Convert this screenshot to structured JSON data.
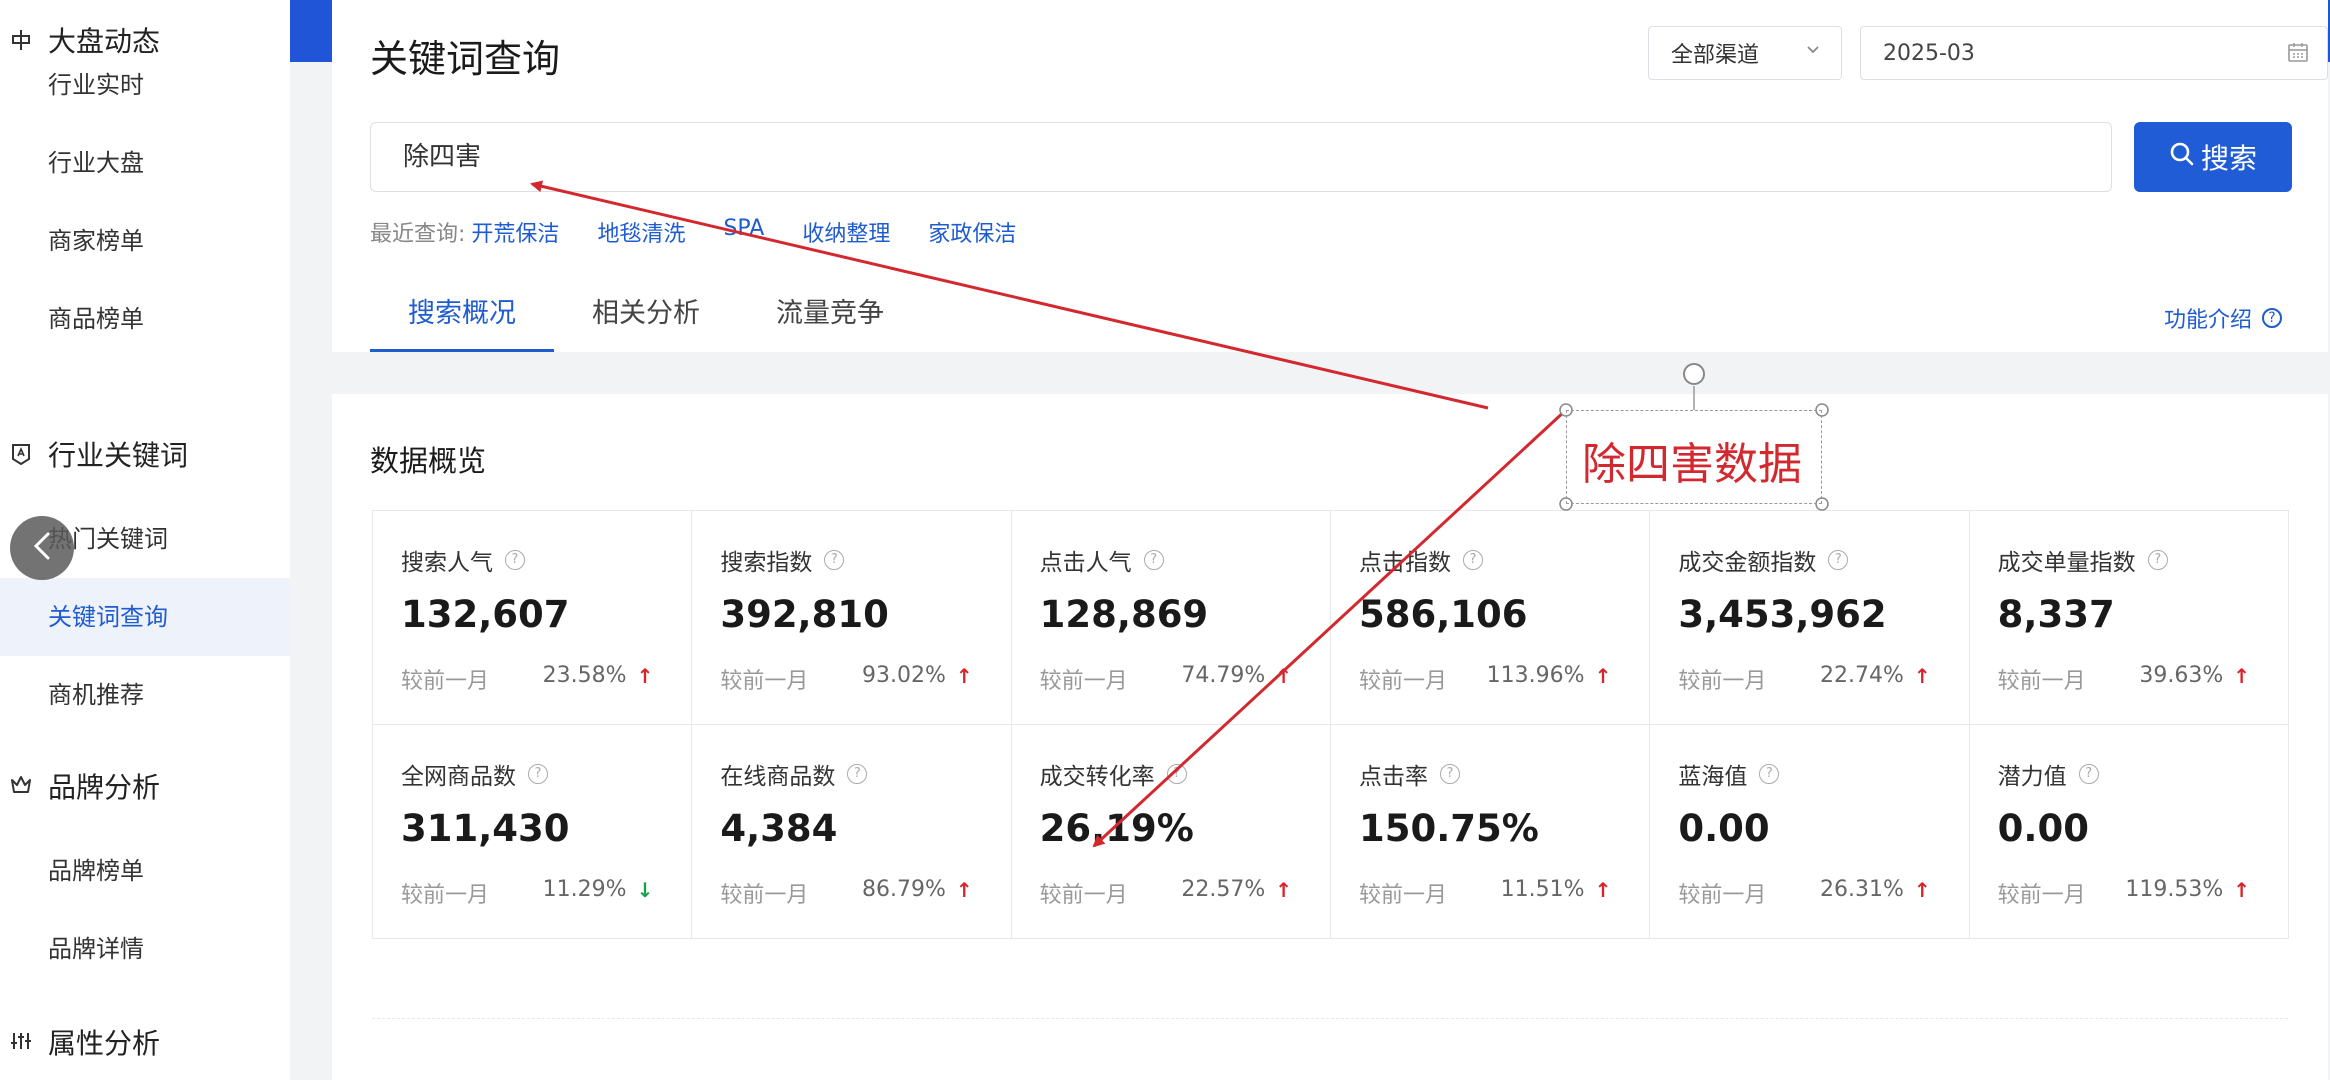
{
  "sidebar": {
    "sections": [
      {
        "label": "大盘动态",
        "icon": "cross-icon"
      },
      {
        "label": "行业关键词",
        "icon": "tag-icon"
      },
      {
        "label": "品牌分析",
        "icon": "crown-icon"
      },
      {
        "label": "属性分析",
        "icon": "sliders-icon"
      }
    ],
    "items": [
      {
        "label": "行业实时"
      },
      {
        "label": "行业大盘"
      },
      {
        "label": "商家榜单"
      },
      {
        "label": "商品榜单"
      },
      {
        "label": "热门关键词"
      },
      {
        "label": "关键词查询"
      },
      {
        "label": "商机推荐"
      },
      {
        "label": "品牌榜单"
      },
      {
        "label": "品牌详情"
      }
    ]
  },
  "header": {
    "title": "关键词查询",
    "channel": "全部渠道",
    "date": "2025-03"
  },
  "search": {
    "value": "除四害",
    "button": "搜索",
    "recent_label": "最近查询:",
    "recent": [
      "开荒保洁",
      "地毯清洗",
      "SPA",
      "收纳整理",
      "家政保洁"
    ]
  },
  "tabs": [
    "搜索概况",
    "相关分析",
    "流量竞争"
  ],
  "func_intro": "功能介绍",
  "overview": {
    "title": "数据概览",
    "compare_label": "较前一月",
    "metrics": [
      {
        "label": "搜索人气",
        "value": "132,607",
        "pct": "23.58%",
        "dir": "up"
      },
      {
        "label": "搜索指数",
        "value": "392,810",
        "pct": "93.02%",
        "dir": "up"
      },
      {
        "label": "点击人气",
        "value": "128,869",
        "pct": "74.79%",
        "dir": "up"
      },
      {
        "label": "点击指数",
        "value": "586,106",
        "pct": "113.96%",
        "dir": "up"
      },
      {
        "label": "成交金额指数",
        "value": "3,453,962",
        "pct": "22.74%",
        "dir": "up"
      },
      {
        "label": "成交单量指数",
        "value": "8,337",
        "pct": "39.63%",
        "dir": "up"
      },
      {
        "label": "全网商品数",
        "value": "311,430",
        "pct": "11.29%",
        "dir": "down"
      },
      {
        "label": "在线商品数",
        "value": "4,384",
        "pct": "86.79%",
        "dir": "up"
      },
      {
        "label": "成交转化率",
        "value": "26.19%",
        "pct": "22.57%",
        "dir": "up"
      },
      {
        "label": "点击率",
        "value": "150.75%",
        "pct": "11.51%",
        "dir": "up"
      },
      {
        "label": "蓝海值",
        "value": "0.00",
        "pct": "26.31%",
        "dir": "up"
      },
      {
        "label": "潜力值",
        "value": "0.00",
        "pct": "119.53%",
        "dir": "up"
      }
    ]
  },
  "annotation": {
    "text": "除四害数据",
    "color": "#d4282f"
  },
  "colors": {
    "accent": "#1f5cd6",
    "up": "#d9232b",
    "down": "#1aa34a"
  }
}
